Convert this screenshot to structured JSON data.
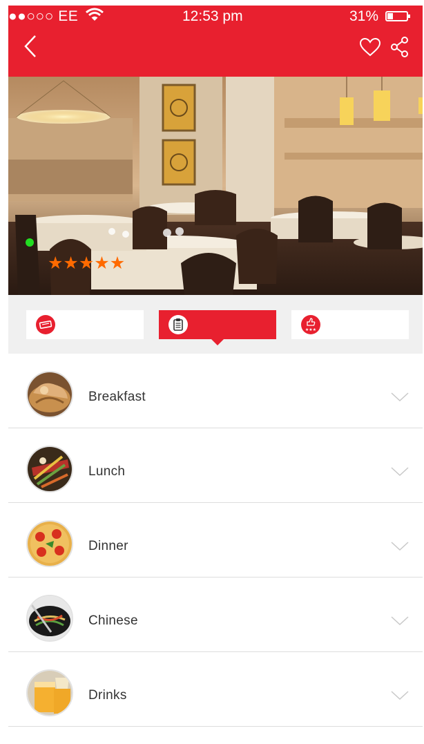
{
  "status_bar": {
    "carrier": "●●○○○ EE",
    "time": "12:53 pm",
    "battery_percent": "31%",
    "battery_level": 0.31
  },
  "colors": {
    "brand_red": "#e8202f",
    "star_orange": "#ff6a00",
    "online_green": "#22dd22"
  },
  "hero": {
    "rating": 5,
    "rating_stars": "★★★★★",
    "online": true
  },
  "tabs": [
    {
      "icon": "ticket-icon",
      "active": false
    },
    {
      "icon": "clipboard-icon",
      "active": true
    },
    {
      "icon": "thumbs-up-rating-icon",
      "active": false
    }
  ],
  "menu": {
    "items": [
      {
        "label": "Breakfast"
      },
      {
        "label": "Lunch"
      },
      {
        "label": "Dinner"
      },
      {
        "label": "Chinese"
      },
      {
        "label": "Drinks"
      }
    ]
  }
}
